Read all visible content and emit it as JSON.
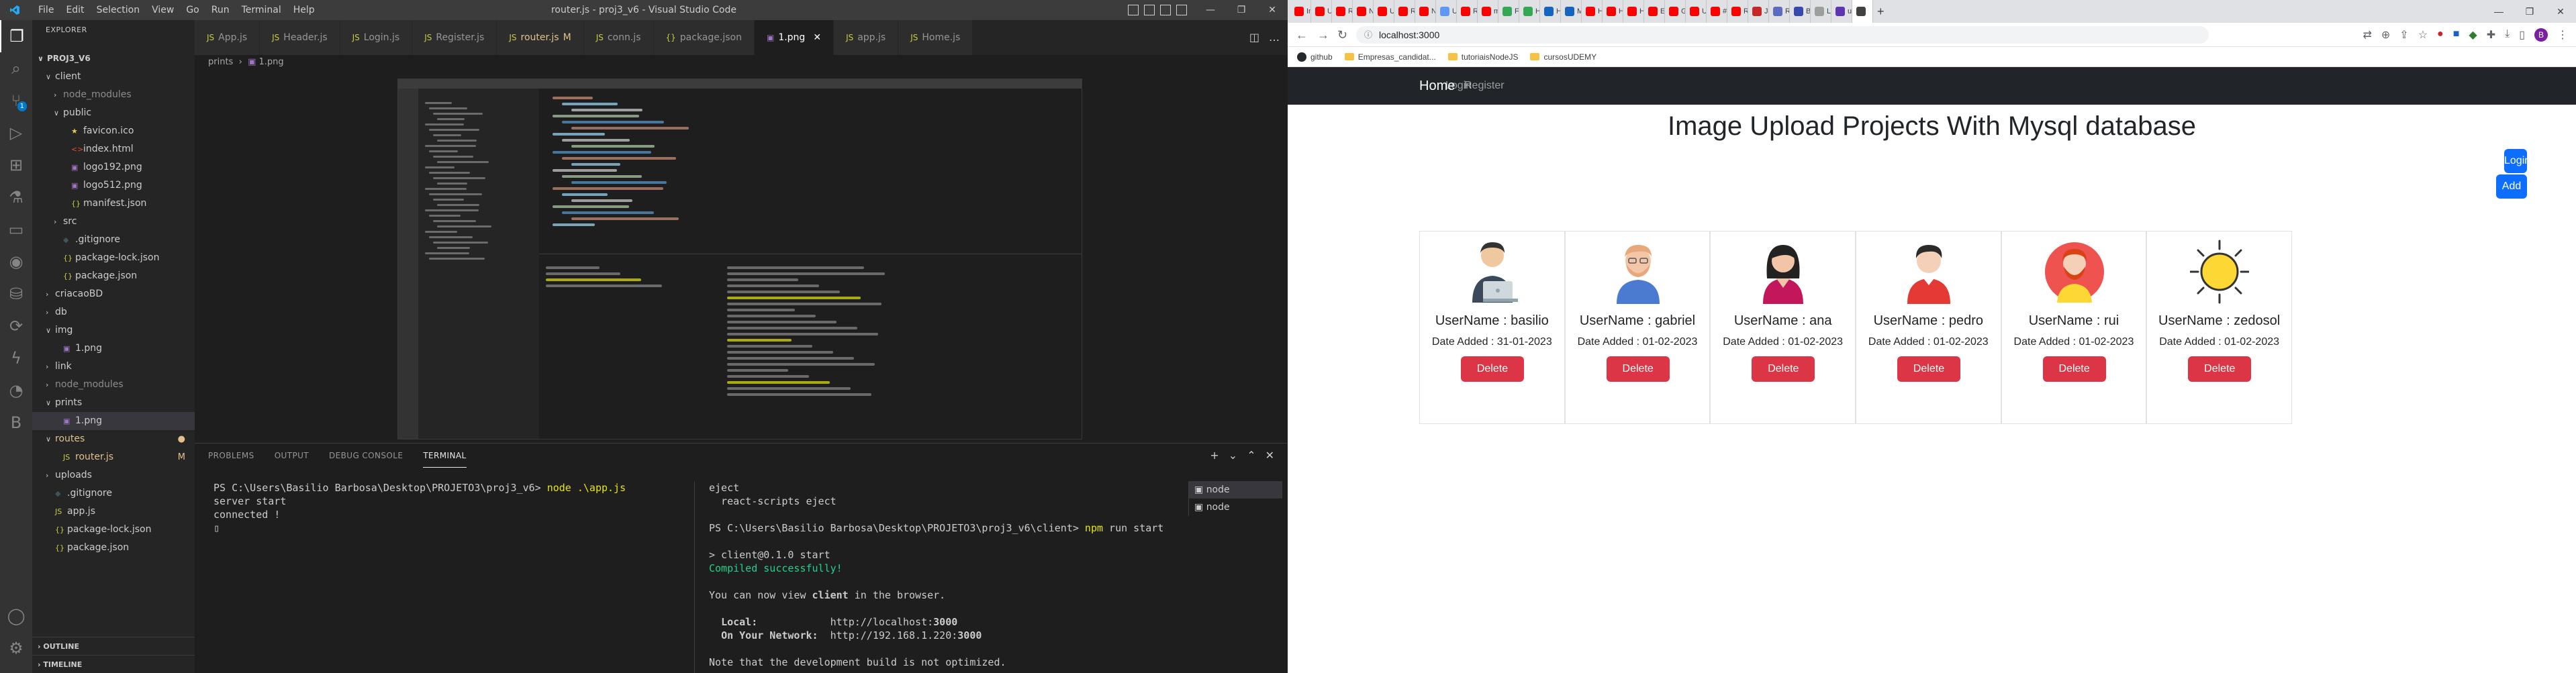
{
  "vscode": {
    "window_title": "router.js - proj3_v6 - Visual Studio Code",
    "menu": [
      "File",
      "Edit",
      "Selection",
      "View",
      "Go",
      "Run",
      "Terminal",
      "Help"
    ],
    "explorer_header": "EXPLORER",
    "tree": [
      {
        "label": "PROJ3_V6",
        "chevron": "∨",
        "icon": "",
        "indent": 0,
        "status": "",
        "color": "#cccccc",
        "bold": true
      },
      {
        "label": "client",
        "chevron": "∨",
        "icon": "",
        "indent": 1,
        "status": "",
        "color": "#cccccc"
      },
      {
        "label": "node_modules",
        "chevron": "›",
        "icon": "",
        "indent": 2,
        "status": "",
        "color": "#8c8c8c"
      },
      {
        "label": "public",
        "chevron": "∨",
        "icon": "",
        "indent": 2,
        "status": "",
        "color": "#cccccc"
      },
      {
        "label": "favicon.ico",
        "chevron": "",
        "icon": "★",
        "indent": 3,
        "status": "",
        "color": "#cccccc",
        "icolor": "#e6c84c"
      },
      {
        "label": "index.html",
        "chevron": "",
        "icon": "<>",
        "indent": 3,
        "status": "",
        "color": "#cccccc",
        "icolor": "#e44d26"
      },
      {
        "label": "logo192.png",
        "chevron": "",
        "icon": "▣",
        "indent": 3,
        "status": "",
        "color": "#cccccc",
        "icolor": "#a074c4"
      },
      {
        "label": "logo512.png",
        "chevron": "",
        "icon": "▣",
        "indent": 3,
        "status": "",
        "color": "#cccccc",
        "icolor": "#a074c4"
      },
      {
        "label": "manifest.json",
        "chevron": "",
        "icon": "{}",
        "indent": 3,
        "status": "",
        "color": "#cccccc",
        "icolor": "#cbcb41"
      },
      {
        "label": "src",
        "chevron": "›",
        "icon": "",
        "indent": 2,
        "status": "",
        "color": "#cccccc"
      },
      {
        "label": ".gitignore",
        "chevron": "",
        "icon": "◆",
        "indent": 2,
        "status": "",
        "color": "#cccccc",
        "icolor": "#41535b"
      },
      {
        "label": "package-lock.json",
        "chevron": "",
        "icon": "{}",
        "indent": 2,
        "status": "",
        "color": "#cccccc",
        "icolor": "#cbcb41"
      },
      {
        "label": "package.json",
        "chevron": "",
        "icon": "{}",
        "indent": 2,
        "status": "",
        "color": "#cccccc",
        "icolor": "#cbcb41"
      },
      {
        "label": "criacaoBD",
        "chevron": "›",
        "icon": "",
        "indent": 1,
        "status": "",
        "color": "#cccccc"
      },
      {
        "label": "db",
        "chevron": "›",
        "icon": "",
        "indent": 1,
        "status": "",
        "color": "#cccccc"
      },
      {
        "label": "img",
        "chevron": "∨",
        "icon": "",
        "indent": 1,
        "status": "",
        "color": "#cccccc"
      },
      {
        "label": "1.png",
        "chevron": "",
        "icon": "▣",
        "indent": 2,
        "status": "",
        "color": "#cccccc",
        "icolor": "#a074c4"
      },
      {
        "label": "link",
        "chevron": "›",
        "icon": "",
        "indent": 1,
        "status": "",
        "color": "#cccccc"
      },
      {
        "label": "node_modules",
        "chevron": "›",
        "icon": "",
        "indent": 1,
        "status": "",
        "color": "#8c8c8c"
      },
      {
        "label": "prints",
        "chevron": "∨",
        "icon": "",
        "indent": 1,
        "status": "",
        "color": "#cccccc"
      },
      {
        "label": "1.png",
        "chevron": "",
        "icon": "▣",
        "indent": 2,
        "status": "",
        "color": "#cccccc",
        "icolor": "#a074c4",
        "selected": true
      },
      {
        "label": "routes",
        "chevron": "∨",
        "icon": "",
        "indent": 1,
        "status": "●",
        "color": "#e2c08d"
      },
      {
        "label": "router.js",
        "chevron": "",
        "icon": "JS",
        "indent": 2,
        "status": "M",
        "color": "#e2c08d",
        "icolor": "#cbcb41"
      },
      {
        "label": "uploads",
        "chevron": "›",
        "icon": "",
        "indent": 1,
        "status": "",
        "color": "#cccccc"
      },
      {
        "label": ".gitignore",
        "chevron": "",
        "icon": "◆",
        "indent": 1,
        "status": "",
        "color": "#cccccc",
        "icolor": "#41535b"
      },
      {
        "label": "app.js",
        "chevron": "",
        "icon": "JS",
        "indent": 1,
        "status": "",
        "color": "#cccccc",
        "icolor": "#cbcb41"
      },
      {
        "label": "package-lock.json",
        "chevron": "",
        "icon": "{}",
        "indent": 1,
        "status": "",
        "color": "#cccccc",
        "icolor": "#cbcb41"
      },
      {
        "label": "package.json",
        "chevron": "",
        "icon": "{}",
        "indent": 1,
        "status": "",
        "color": "#cccccc",
        "icolor": "#cbcb41"
      }
    ],
    "outline": "OUTLINE",
    "timeline": "TIMELINE",
    "tabs": [
      {
        "label": "App.js",
        "icon": "JS",
        "mod": "",
        "active": false
      },
      {
        "label": "Header.js",
        "icon": "JS",
        "mod": "",
        "active": false
      },
      {
        "label": "Login.js",
        "icon": "JS",
        "mod": "",
        "active": false
      },
      {
        "label": "Register.js",
        "icon": "JS",
        "mod": "",
        "active": false
      },
      {
        "label": "router.js",
        "icon": "JS",
        "mod": "M",
        "active": false
      },
      {
        "label": "conn.js",
        "icon": "JS",
        "mod": "",
        "active": false
      },
      {
        "label": "package.json",
        "icon": "{}",
        "mod": "",
        "active": false
      },
      {
        "label": "1.png",
        "icon": "▣",
        "mod": "",
        "active": true
      },
      {
        "label": "app.js",
        "icon": "JS",
        "mod": "",
        "active": false
      },
      {
        "label": "Home.js",
        "icon": "JS",
        "mod": "",
        "active": false
      }
    ],
    "breadcrumb": [
      "prints",
      "1.png"
    ],
    "panel_tabs": [
      "PROBLEMS",
      "OUTPUT",
      "DEBUG CONSOLE",
      "TERMINAL"
    ],
    "terminal_left": [
      {
        "t": "PS C:\\Users\\Basilio Barbosa\\Desktop\\PROJETO3\\proj3_v6> ",
        "c": ""
      },
      {
        "t": "node .\\app.js",
        "c": "y"
      },
      {
        "t": "\nserver start\nconnected !\n▯",
        "c": ""
      }
    ],
    "terminal_right": [
      {
        "t": "eject\n  react-scripts eject\n\nPS C:\\Users\\Basilio Barbosa\\Desktop\\PROJETO3\\proj3_v6\\client> ",
        "c": ""
      },
      {
        "t": "npm",
        "c": "y"
      },
      {
        "t": " run start\n\n> client@0.1.0 start\n",
        "c": ""
      },
      {
        "t": "Compiled successfully!",
        "c": "g"
      },
      {
        "t": "\n\nYou can now view ",
        "c": ""
      },
      {
        "t": "client",
        "c": "b"
      },
      {
        "t": " in the browser.\n\n  ",
        "c": ""
      },
      {
        "t": "Local:",
        "c": "b"
      },
      {
        "t": "            http://localhost:",
        "c": ""
      },
      {
        "t": "3000",
        "c": "b"
      },
      {
        "t": "\n  ",
        "c": ""
      },
      {
        "t": "On Your Network:",
        "c": "b"
      },
      {
        "t": "  http://192.168.1.220:",
        "c": ""
      },
      {
        "t": "3000",
        "c": "b"
      },
      {
        "t": "\n\nNote that the development build is not optimized.",
        "c": ""
      }
    ],
    "terminal_instances": [
      "node",
      "node"
    ]
  },
  "browser": {
    "url": "localhost:3000",
    "tabs": [
      {
        "title": "Ima",
        "color": "#ff0000"
      },
      {
        "title": "Upl",
        "color": "#ff0000"
      },
      {
        "title": "Rea",
        "color": "#ff0000"
      },
      {
        "title": "Nu",
        "color": "#ff0000"
      },
      {
        "title": "Upl",
        "color": "#ff0000"
      },
      {
        "title": "Rea",
        "color": "#ff0000"
      },
      {
        "title": "Nu",
        "color": "#ff0000"
      },
      {
        "title": "Upl",
        "color": "#5e97f6"
      },
      {
        "title": "Rea",
        "color": "#ff0000"
      },
      {
        "title": "mo",
        "color": "#ff0000"
      },
      {
        "title": "File",
        "color": "#34a853"
      },
      {
        "title": "Ha",
        "color": "#34a853"
      },
      {
        "title": "Hos",
        "color": "#1565c0"
      },
      {
        "title": "Mu",
        "color": "#1565c0"
      },
      {
        "title": "Hin",
        "color": "#ff0000"
      },
      {
        "title": "Hor",
        "color": "#ff0000"
      },
      {
        "title": "Hor",
        "color": "#ff0000"
      },
      {
        "title": "Err",
        "color": "#ff0000"
      },
      {
        "title": "Ger",
        "color": "#ff0000"
      },
      {
        "title": "Upl",
        "color": "#ff0000"
      },
      {
        "title": "#13",
        "color": "#ff0000"
      },
      {
        "title": "Res",
        "color": "#ff0000"
      },
      {
        "title": "Jeff",
        "color": "#c62828"
      },
      {
        "title": "Re",
        "color": "#5c6bc0"
      },
      {
        "title": "Bas",
        "color": "#3949ab"
      },
      {
        "title": "Log",
        "color": "#9e9e9e"
      },
      {
        "title": "use",
        "color": "#5e35b1"
      },
      {
        "title": "",
        "color": "#424242",
        "active": true
      }
    ],
    "bookmarks": [
      {
        "label": "github",
        "kind": "gh"
      },
      {
        "label": "Empresas_candidat...",
        "kind": "folder"
      },
      {
        "label": "tutoriaisNodeJS",
        "kind": "folder"
      },
      {
        "label": "cursosUDEMY",
        "kind": "folder"
      }
    ],
    "profile_initial": "B"
  },
  "app": {
    "nav": {
      "brand": "Home",
      "links": [
        "Login",
        "Register"
      ]
    },
    "title": "Image Upload Projects With Mysql database",
    "login_button": "Login",
    "add_user_button": "Add User",
    "users": [
      {
        "username": "UserName : basilio",
        "date": "Date Added : 31-01-2023",
        "avatar": "man-laptop"
      },
      {
        "username": "UserName : gabriel",
        "date": "Date Added : 01-02-2023",
        "avatar": "man-beard"
      },
      {
        "username": "UserName : ana",
        "date": "Date Added : 01-02-2023",
        "avatar": "woman"
      },
      {
        "username": "UserName : pedro",
        "date": "Date Added : 01-02-2023",
        "avatar": "man-red"
      },
      {
        "username": "UserName : rui",
        "date": "Date Added : 01-02-2023",
        "avatar": "man-red-beard"
      },
      {
        "username": "UserName : zedosol",
        "date": "Date Added : 01-02-2023",
        "avatar": "sun"
      }
    ],
    "delete_label": "Delete"
  }
}
